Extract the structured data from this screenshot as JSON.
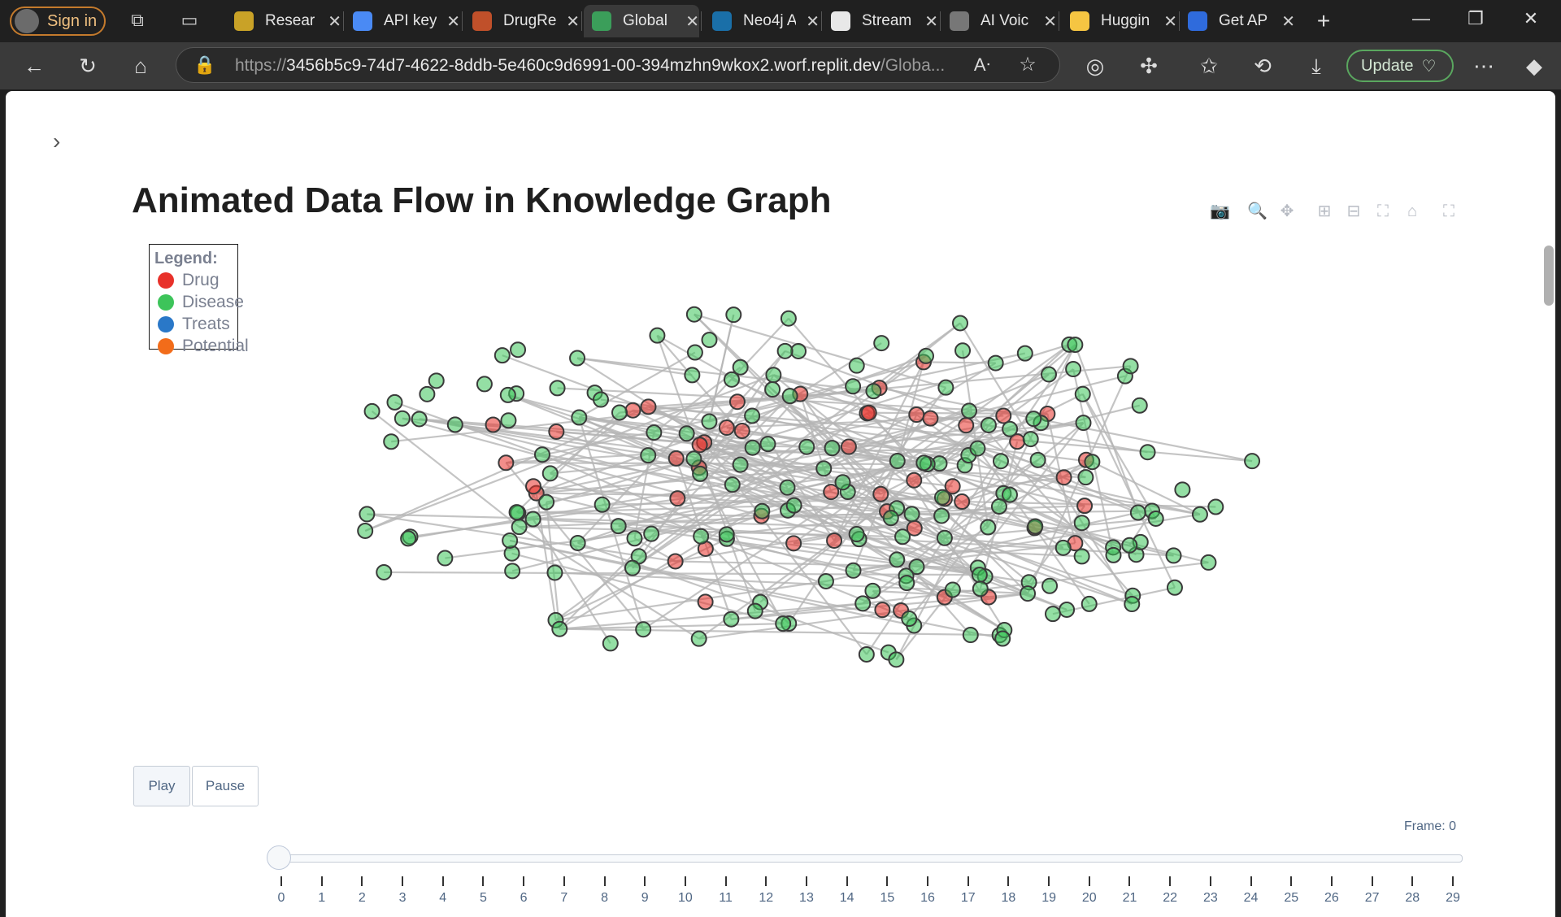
{
  "browser": {
    "signin_label": "Sign in",
    "tabs": [
      {
        "label": "Resear",
        "fav_color": "#c9a227"
      },
      {
        "label": "API key",
        "fav_color": "#4a8af4"
      },
      {
        "label": "DrugRe",
        "fav_color": "#c0502a"
      },
      {
        "label": "Global",
        "fav_color": "#3b9e5a"
      },
      {
        "label": "Neo4j A",
        "fav_color": "#1a6fa8"
      },
      {
        "label": "Stream",
        "fav_color": "#e8e8e8"
      },
      {
        "label": "AI Voic",
        "fav_color": "#777777"
      },
      {
        "label": "Huggin",
        "fav_color": "#f5c542"
      },
      {
        "label": "Get AP",
        "fav_color": "#2f6bdc"
      }
    ],
    "url_prefix": "https://",
    "url_host": "3456b5c9-74d7-4622-8ddb-5e460c9d6991-00-394mzhn9wkox2.worf.replit.dev",
    "url_path": "/Globa...",
    "update_label": "Update"
  },
  "page": {
    "title": "Animated Data Flow in Knowledge Graph",
    "legend": {
      "heading": "Legend:",
      "items": [
        {
          "label": "Drug",
          "color": "#e8312a"
        },
        {
          "label": "Disease",
          "color": "#3dc45a"
        },
        {
          "label": "Treats",
          "color": "#2a78c8"
        },
        {
          "label": "Potential",
          "color": "#f26c1a"
        }
      ]
    },
    "controls": {
      "play_label": "Play",
      "pause_label": "Pause"
    },
    "frame_label": "Frame: 0",
    "slider": {
      "value": 0,
      "steps": [
        "0",
        "1",
        "2",
        "3",
        "4",
        "5",
        "6",
        "7",
        "8",
        "9",
        "10",
        "11",
        "12",
        "13",
        "14",
        "15",
        "16",
        "17",
        "18",
        "19",
        "20",
        "21",
        "22",
        "23",
        "24",
        "25",
        "26",
        "27",
        "28",
        "29"
      ]
    }
  },
  "chart_data": {
    "type": "network",
    "node_colors": {
      "drug": "#e8312a",
      "disease": "#3dc45a",
      "edge": "#b5b5b5"
    },
    "node_counts": {
      "drug": 50,
      "disease": 190
    }
  }
}
